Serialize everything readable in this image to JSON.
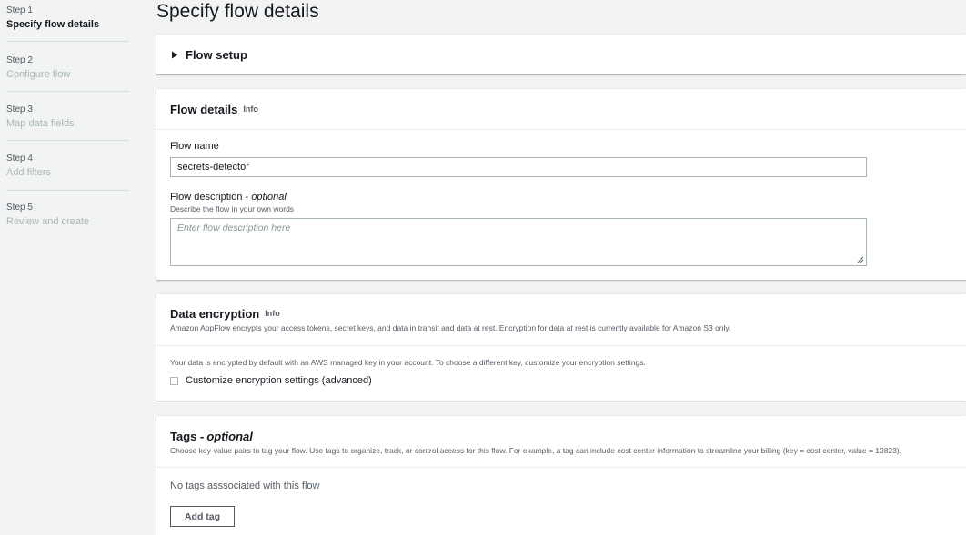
{
  "steps": [
    {
      "num": "Step 1",
      "label": "Specify flow details",
      "active": true
    },
    {
      "num": "Step 2",
      "label": "Configure flow",
      "active": false
    },
    {
      "num": "Step 3",
      "label": "Map data fields",
      "active": false
    },
    {
      "num": "Step 4",
      "label": "Add filters",
      "active": false
    },
    {
      "num": "Step 5",
      "label": "Review and create",
      "active": false
    }
  ],
  "page_title": "Specify flow details",
  "flow_setup": {
    "title": "Flow setup",
    "expanded": false
  },
  "flow_details": {
    "title": "Flow details",
    "info": "Info",
    "name_label": "Flow name",
    "name_value": "secrets-detector",
    "desc_label": "Flow description - ",
    "desc_optional": "optional",
    "desc_sublabel": "Describe the flow in your own words",
    "desc_placeholder": "Enter flow description here"
  },
  "data_encryption": {
    "title": "Data encryption",
    "info": "Info",
    "description": "Amazon AppFlow encrypts your access tokens, secret keys, and data in transit and data at rest. Encryption for data at rest is currently available for Amazon S3 only.",
    "body": "Your data is encrypted by default with an AWS managed key in your account. To choose a different key, customize your encryption settings.",
    "checkbox_label": "Customize encryption settings (advanced)",
    "checked": false
  },
  "tags": {
    "title": "Tags - ",
    "title_optional": "optional",
    "description": "Choose key-value pairs to tag your flow. Use tags to organize, track, or control access for this flow. For example, a tag can include cost center information to streamline your billing (key = cost center, value = 10823).",
    "empty_text": "No tags asssociated with this flow",
    "add_button": "Add tag"
  }
}
